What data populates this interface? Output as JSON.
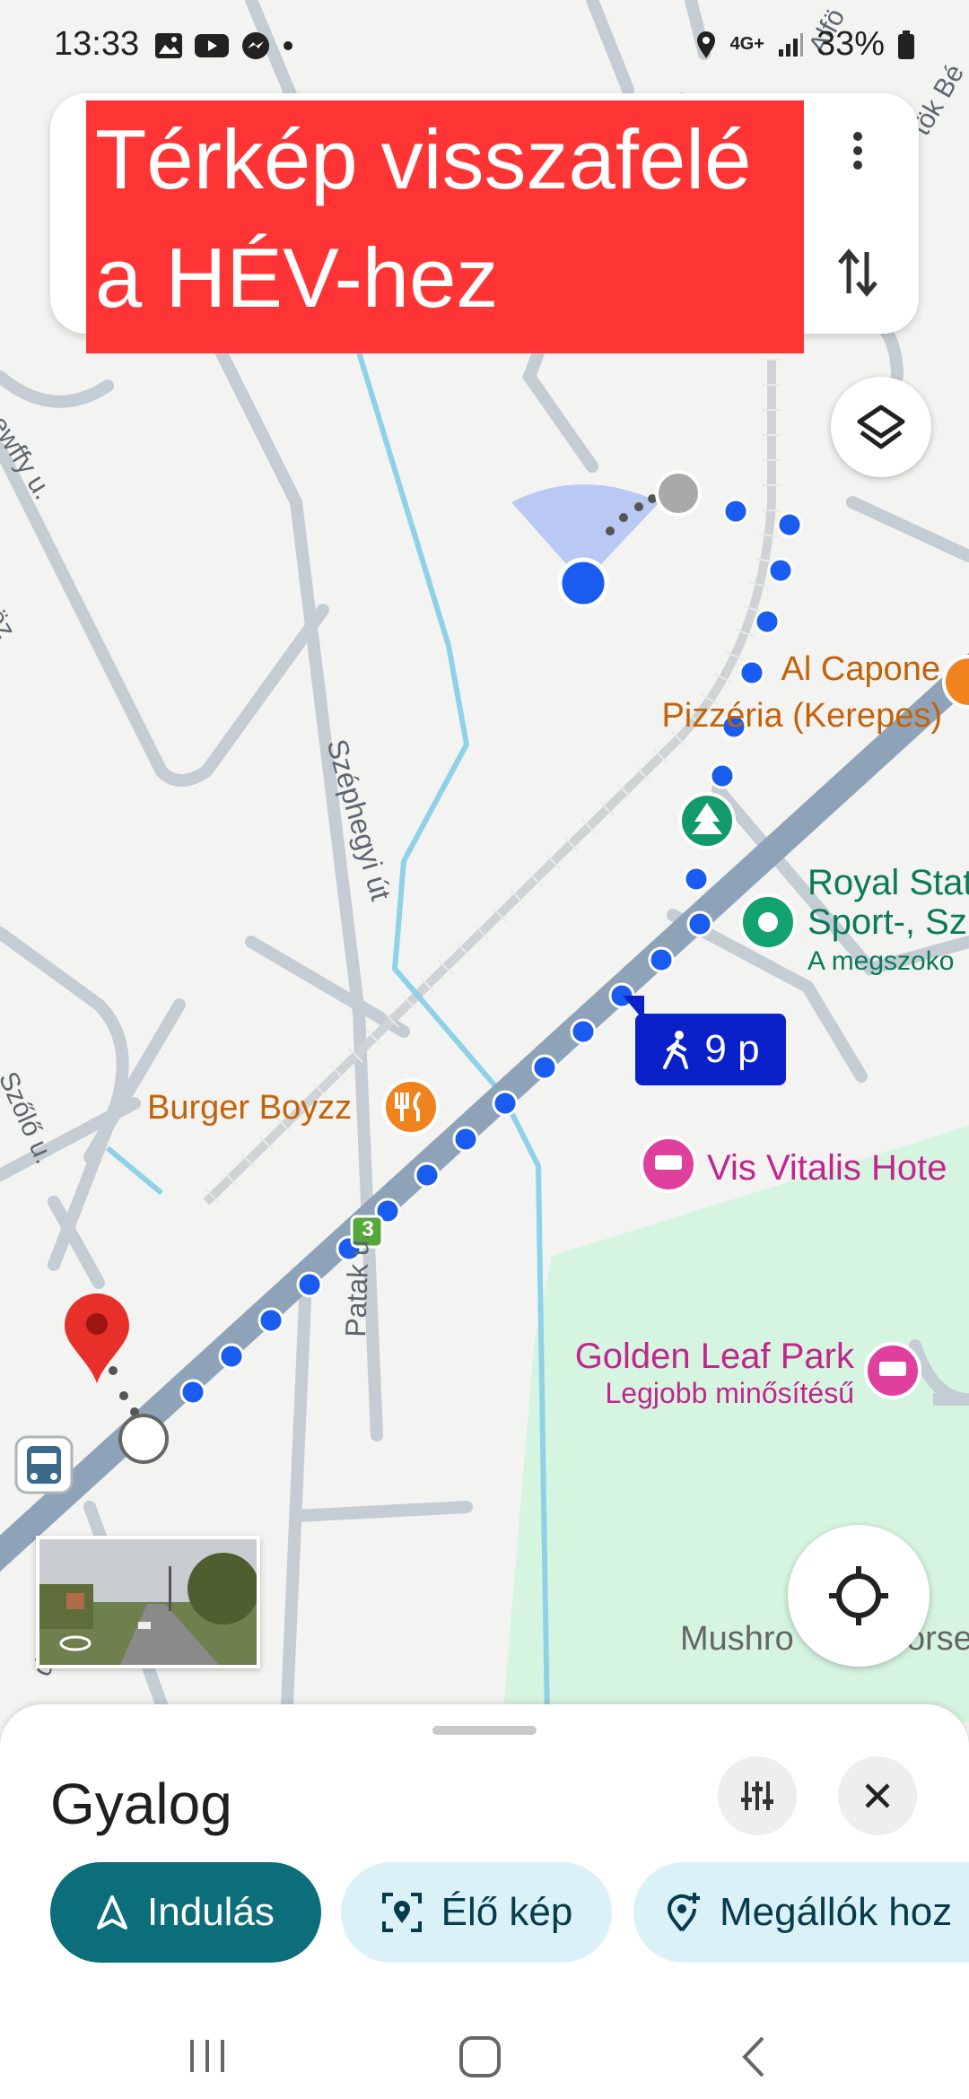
{
  "status_bar": {
    "time": "13:33",
    "network": "4G+",
    "battery": "33%",
    "left_icons": [
      "gallery-icon",
      "youtube-icon",
      "messenger-icon",
      "dot-icon"
    ],
    "right_icons": [
      "location-icon",
      "signal-icon",
      "battery-icon"
    ]
  },
  "banner": {
    "line1": "Térkép visszafelé",
    "line2": "a HÉV-hez"
  },
  "map": {
    "streets": {
      "dessewffy": "Dessewffy u.",
      "koz": "köz",
      "szephegyi": "Széphegyi út",
      "szolo": "Szőlő u.",
      "patak": "Patak u.",
      "bottom_left": "d u.",
      "alfoldi": "Alfö",
      "tok": "tök Bé"
    },
    "pois": {
      "al_capone_line1": "Al Capone",
      "al_capone_line2": "Pizzéria (Kerepes)",
      "royal_line1": "Royal Stat",
      "royal_line2": "Sport-, Sz",
      "royal_line3": "A megszoko",
      "burger": "Burger Boyzz",
      "vis_vitalis": "Vis Vitalis Hote",
      "golden_line1": "Golden Leaf Park",
      "golden_line2": "Legjobb minősítésű",
      "mushroom": "Mushro",
      "mushroom2": "orse"
    },
    "route_badge": "3",
    "walk_time": "9 p"
  },
  "sheet": {
    "title": "Gyalog",
    "start_label": "Indulás",
    "live_view_label": "Élő kép",
    "stops_label": "Megállók hoz"
  },
  "colors": {
    "route_blue": "#1a5cf0",
    "primary_teal": "#0b6e7a",
    "chip_bg": "#d9f1f7",
    "banner_red": "#ff3535",
    "walk_badge": "#0a21c9"
  }
}
